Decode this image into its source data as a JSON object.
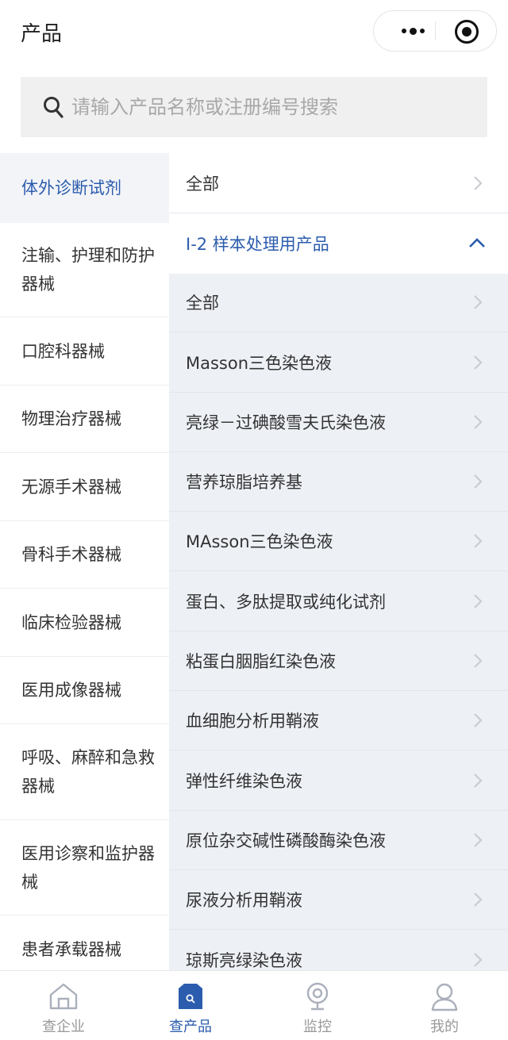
{
  "header": {
    "title": "产品"
  },
  "search": {
    "placeholder": "请输入产品名称或注册编号搜索"
  },
  "categories": [
    {
      "label": "体外诊断试剂",
      "active": true
    },
    {
      "label": "注输、护理和防护器械"
    },
    {
      "label": "口腔科器械"
    },
    {
      "label": "物理治疗器械"
    },
    {
      "label": "无源手术器械"
    },
    {
      "label": "骨科手术器械"
    },
    {
      "label": "临床检验器械"
    },
    {
      "label": "医用成像器械"
    },
    {
      "label": "呼吸、麻醉和急救器械"
    },
    {
      "label": "医用诊察和监护器械"
    },
    {
      "label": "患者承载器械"
    }
  ],
  "top_item": {
    "label": "全部"
  },
  "group": {
    "label": "I-2 样本处理用产品",
    "expanded": true
  },
  "sub_items": [
    "全部",
    "Masson三色染色液",
    "亮绿－过碘酸雪夫氏染色液",
    "营养琼脂培养基",
    "MAsson三色染色液",
    "蛋白、多肽提取或纯化试剂",
    "粘蛋白胭脂红染色液",
    "血细胞分析用鞘液",
    "弹性纤维染色液",
    "原位杂交碱性磷酸酶染色液",
    "尿液分析用鞘液",
    "琼斯亮绿染色液"
  ],
  "tabs": [
    {
      "label": "查企业",
      "icon": "building-icon"
    },
    {
      "label": "查产品",
      "icon": "product-search-icon",
      "active": true
    },
    {
      "label": "监控",
      "icon": "camera-icon"
    },
    {
      "label": "我的",
      "icon": "user-icon"
    }
  ],
  "colors": {
    "accent": "#2b5cad",
    "panel_bg": "#edf0f5",
    "inactive": "#999999"
  }
}
